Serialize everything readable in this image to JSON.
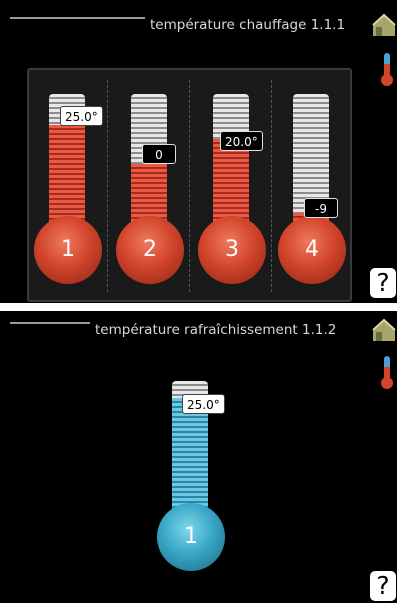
{
  "panel1": {
    "title": "température chauffage 1.1.1",
    "help_label": "?",
    "thermometers": [
      {
        "bulb_label": "1",
        "tag": "25.0°",
        "fill_fraction": 0.78
      },
      {
        "bulb_label": "2",
        "tag": "0",
        "fill_fraction": 0.5
      },
      {
        "bulb_label": "3",
        "tag": "20.0°",
        "fill_fraction": 0.68
      },
      {
        "bulb_label": "4",
        "tag": "-9",
        "fill_fraction": 0.15
      }
    ]
  },
  "panel2": {
    "title": "température rafraîchissement 1.1.2",
    "help_label": "?",
    "thermometer": {
      "bulb_label": "1",
      "tag": "25.0°",
      "fill_fraction": 0.88
    }
  },
  "colors": {
    "heat": "#d2452c",
    "cool": "#3aa6c6",
    "background": "#000000"
  },
  "icons": [
    "home-icon",
    "thermometer-icon",
    "help-icon"
  ]
}
